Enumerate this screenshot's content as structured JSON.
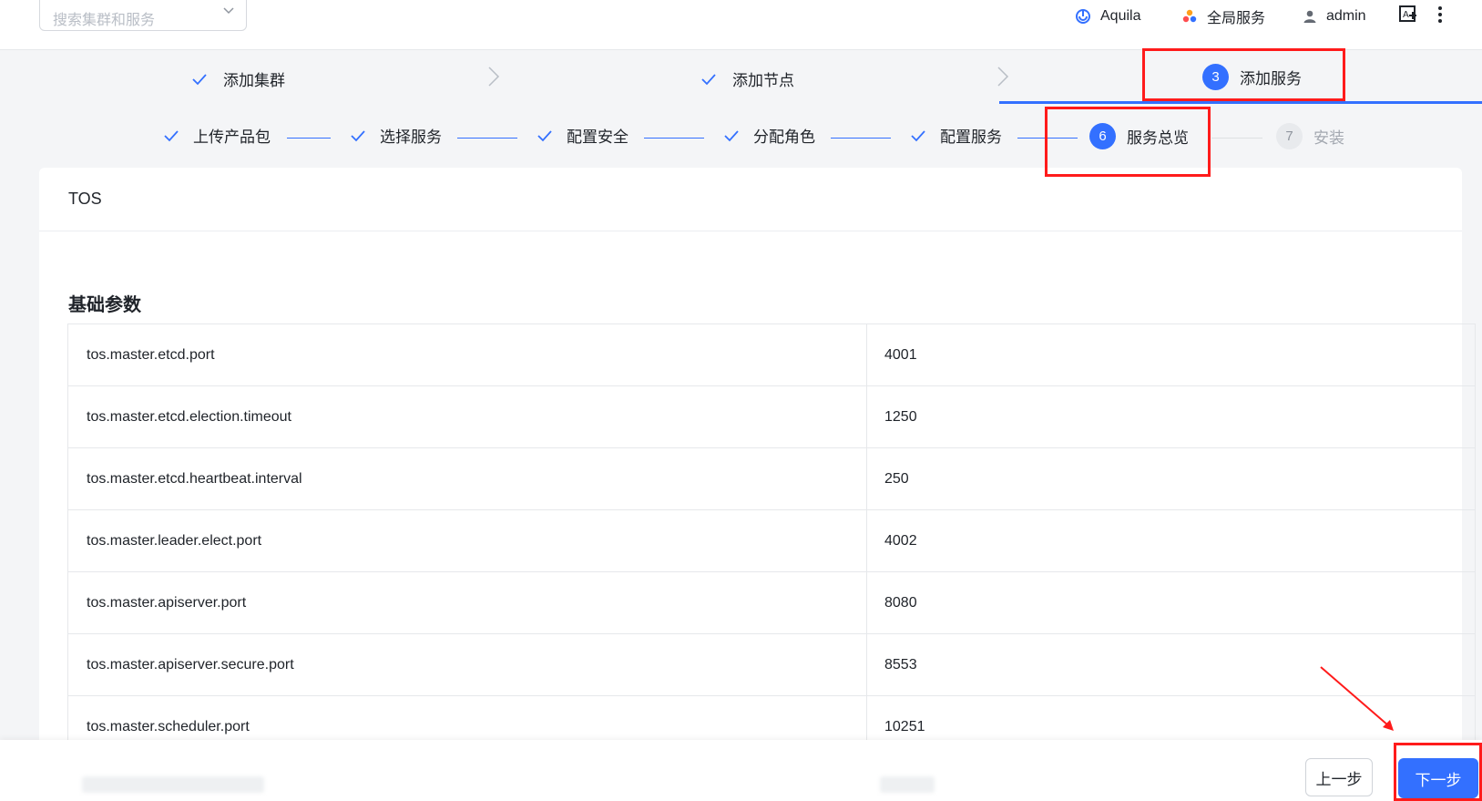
{
  "header": {
    "search_placeholder": "搜索集群和服务",
    "cluster_name": "Aquila",
    "global_services": "全局服务",
    "user": "admin"
  },
  "wizard": {
    "steps": [
      {
        "label": "添加集群",
        "status": "done"
      },
      {
        "label": "添加节点",
        "status": "done"
      },
      {
        "number": "3",
        "label": "添加服务",
        "status": "active"
      }
    ]
  },
  "substeps": [
    {
      "label": "上传产品包",
      "status": "done"
    },
    {
      "label": "选择服务",
      "status": "done"
    },
    {
      "label": "配置安全",
      "status": "done"
    },
    {
      "label": "分配角色",
      "status": "done"
    },
    {
      "label": "配置服务",
      "status": "done"
    },
    {
      "number": "6",
      "label": "服务总览",
      "status": "active"
    },
    {
      "number": "7",
      "label": "安装",
      "status": "pending"
    }
  ],
  "card": {
    "title": "TOS",
    "section_title": "基础参数",
    "params": [
      {
        "key": "tos.master.etcd.port",
        "value": "4001"
      },
      {
        "key": "tos.master.etcd.election.timeout",
        "value": "1250"
      },
      {
        "key": "tos.master.etcd.heartbeat.interval",
        "value": "250"
      },
      {
        "key": "tos.master.leader.elect.port",
        "value": "4002"
      },
      {
        "key": "tos.master.apiserver.port",
        "value": "8080"
      },
      {
        "key": "tos.master.apiserver.secure.port",
        "value": "8553"
      },
      {
        "key": "tos.master.scheduler.port",
        "value": "10251"
      }
    ]
  },
  "footer": {
    "prev_label": "上一步",
    "next_label": "下一步"
  },
  "colors": {
    "accent": "#3370ff",
    "highlight": "#ff1b1b"
  }
}
